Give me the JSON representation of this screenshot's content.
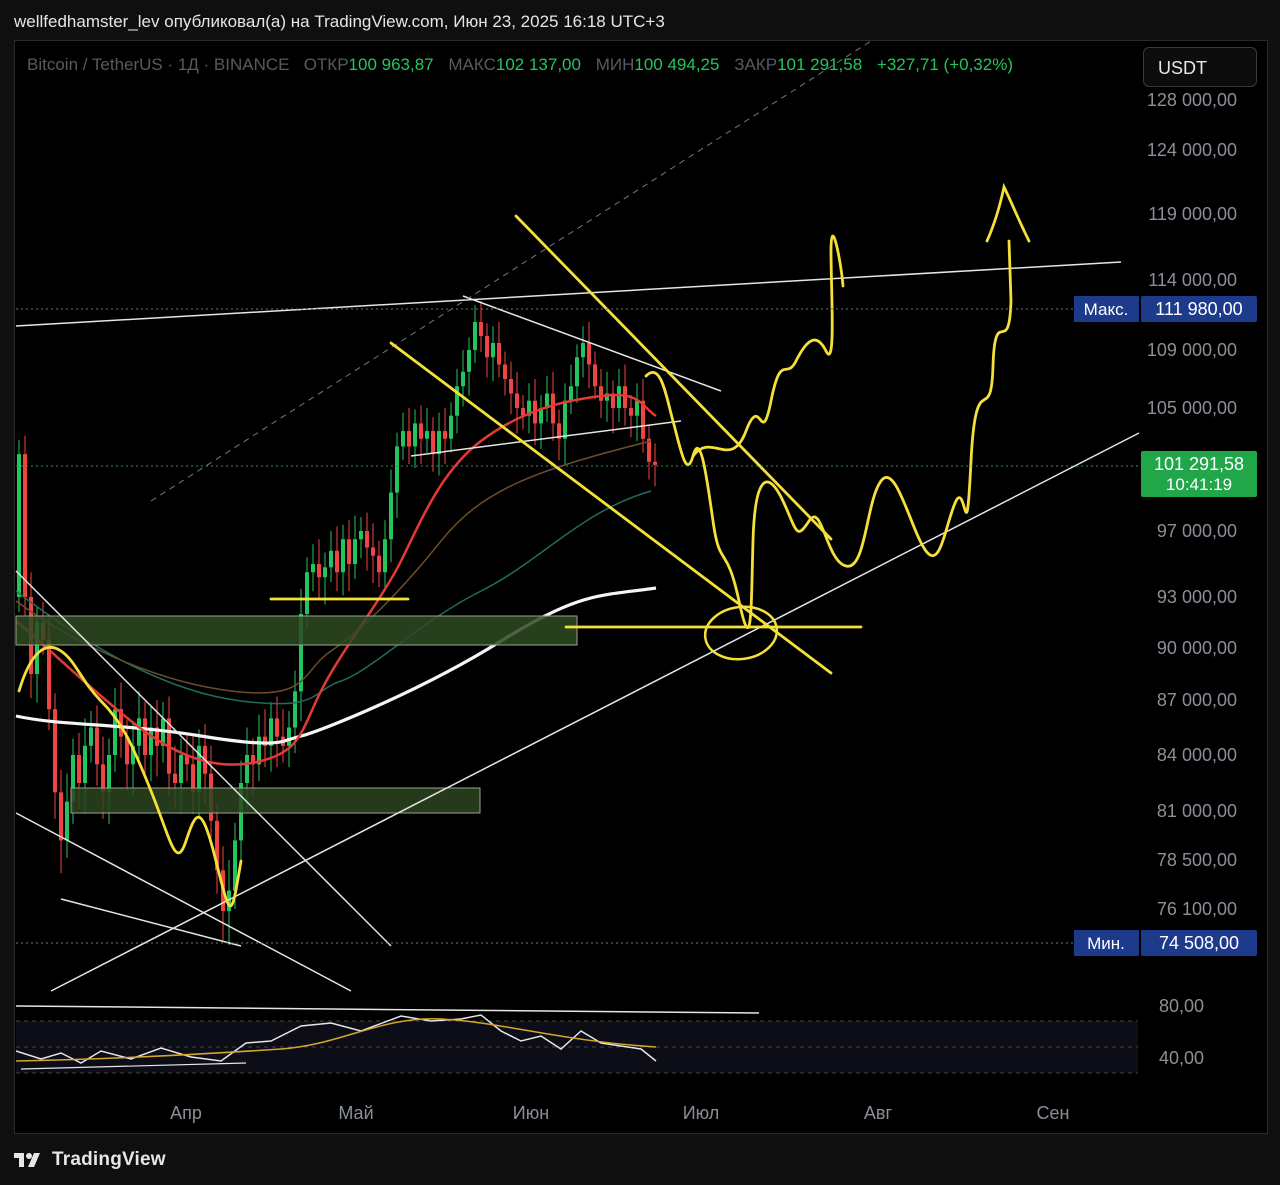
{
  "header": {
    "post_line": "wellfedhamster_lev опубликовал(а) на TradingView.com, Июн 23, 2025 16:18 UTC+3"
  },
  "legend": {
    "symbol": "Bitcoin / TetherUS · 1Д · BINANCE",
    "open_label": "ОТКР",
    "open_value": "100 963,87",
    "high_label": "МАКС",
    "high_value": "102 137,00",
    "low_label": "МИН",
    "low_value": "100 494,25",
    "close_label": "ЗАКР",
    "close_value": "101 291,58",
    "change": "+327,71 (+0,32%)"
  },
  "currency_button": "USDT",
  "footer": {
    "brand": "TradingView"
  },
  "colors": {
    "up": "#22c55e",
    "down": "#ef4444",
    "drawing": "#f5e03a",
    "ma_fast": "#e53935",
    "ma_slow": "#f5f5f5",
    "ma_mid": "#6d4c2a",
    "ma_teal": "#1e6e5a",
    "badge_blue": "#1e3a8a",
    "badge_green": "#22a64a"
  },
  "chart_data": {
    "type": "candlestick",
    "price_axis": [
      "128 000,00",
      "124 000,00",
      "119 000,00",
      "114 000,00",
      "109 000,00",
      "105 000,00",
      "97 000,00",
      "93 000,00",
      "90 000,00",
      "87 000,00",
      "84 000,00",
      "81 000,00",
      "78 500,00",
      "76 100,00"
    ],
    "time_axis": [
      "Апр",
      "Май",
      "Июн",
      "Июл",
      "Авг",
      "Сен"
    ],
    "price_badges": [
      {
        "label": "Макс.",
        "value": "111 980,00"
      },
      {
        "label": "",
        "value": "101 291,58",
        "sub": "10:41:19"
      },
      {
        "label": "Мин.",
        "value": "74 508,00"
      }
    ],
    "rsi_axis": [
      "80,00",
      "40,00"
    ],
    "last_price": 101291.58,
    "high": 111980.0,
    "low": 74508.0
  }
}
